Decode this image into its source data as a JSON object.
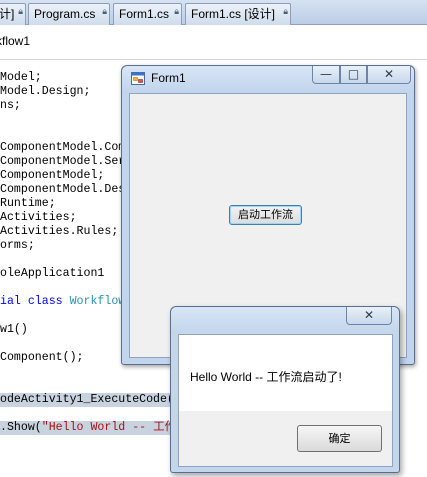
{
  "ide": {
    "tabs": [
      {
        "label": "计]"
      },
      {
        "label": "Program.cs"
      },
      {
        "label": "Form1.cs"
      },
      {
        "label": "Form1.cs [设计]"
      }
    ],
    "navbar_text": "rkflow1"
  },
  "code_lines": [
    "Model;",
    "Model.Design;",
    "ns;",
    "",
    "ComponentModel.Com",
    "ComponentModel.Ser",
    "ComponentModel;",
    "ComponentModel.Des",
    "Runtime;",
    "Activities;",
    "Activities.Rules;",
    "orms;",
    "",
    "oleApplication1",
    "",
    "ial class Workflow",
    "",
    "w1()",
    "",
    "Component();",
    "",
    "",
    "odeActivity1_ExecuteCode(",
    "",
    ".Show(\"Hello World -- 工作"
  ],
  "form1": {
    "title": "Form1",
    "minimize_glyph": "—",
    "maximize_glyph": "□",
    "close_glyph": "✕",
    "button_label": "启动工作流"
  },
  "message_box": {
    "close_glyph": "✕",
    "text": "Hello World -- 工作流启动了!",
    "ok_label": "确定"
  },
  "colors": {
    "keyword": "#0000ff",
    "type": "#2b91af",
    "string": "#a31515",
    "selection": "#c9d3e0"
  }
}
